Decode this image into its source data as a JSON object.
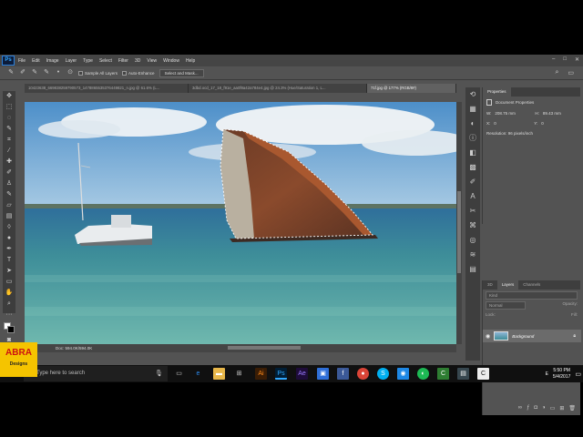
{
  "menu": {
    "logo": "Ps",
    "items": [
      "File",
      "Edit",
      "Image",
      "Layer",
      "Type",
      "Select",
      "Filter",
      "3D",
      "View",
      "Window",
      "Help"
    ]
  },
  "options": {
    "sample_all_layers": "Sample All Layers",
    "auto_enhance": "Auto-Enhance",
    "select_and_mask": "Select and Mask..."
  },
  "tabs": [
    "10423638_669838259790573_1478865535376449821_n.jpg @ 61.6% (L...",
    "3dbd.ocd_17_18_f91e_aa0f8a42a784e4.jpg @ 24.3% (Hue/Saturation 1, L...",
    "71f.jpg @ 177% (RGB/8#)"
  ],
  "status": {
    "doc": "Doc: 594.0K/594.0K"
  },
  "properties": {
    "tab": "Properties",
    "doc_title": "Document Properties",
    "w_label": "W:",
    "w_value": "208.75 mm",
    "h_label": "H:",
    "h_value": "89.43 mm",
    "x_label": "X:",
    "x_value": "0",
    "y_label": "Y:",
    "y_value": "0",
    "resolution": "Resolution: 96 pixels/inch"
  },
  "layers": {
    "tab_3d": "3D",
    "tab_layers": "Layers",
    "tab_channels": "Channels",
    "search": "Kind",
    "blend_mode": "Normal",
    "opacity": "Opacity:",
    "lock": "Lock:",
    "fill": "Fill:",
    "layer_name": "Background"
  },
  "taskbar": {
    "search_placeholder": "Type here to search",
    "time": "5:50 PM",
    "date": "5/4/2017",
    "lang": "E"
  },
  "logo": {
    "line1": "ABRA",
    "line2": "Designs"
  },
  "colors": {
    "ps_chrome": "#535353",
    "menu_bg": "#454545",
    "ps_blue": "#31a8ff",
    "taskbar": "#101010",
    "logo_yellow": "#f5c400"
  }
}
